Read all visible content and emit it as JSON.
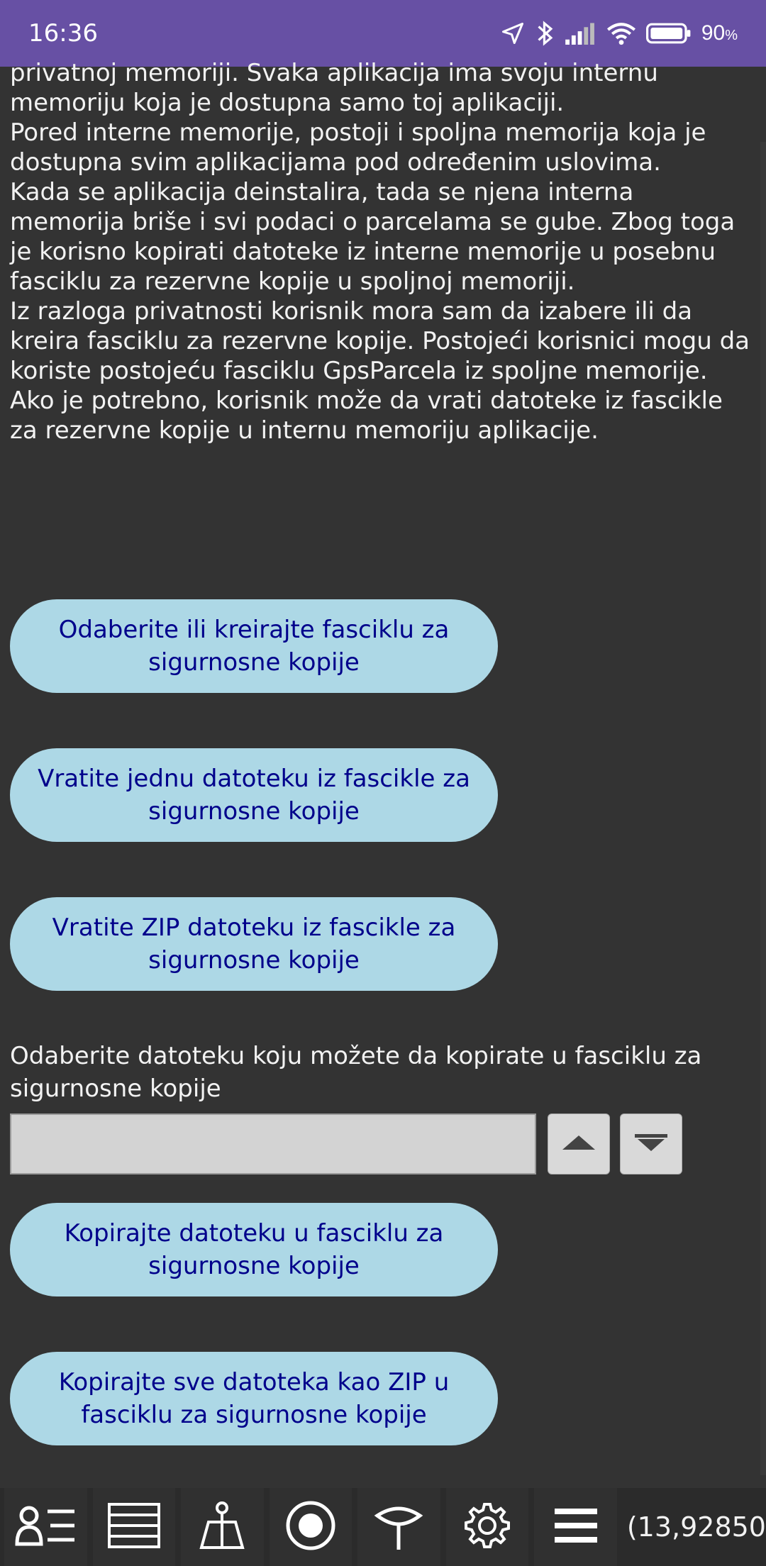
{
  "status_bar": {
    "time": "16:36",
    "battery": "90",
    "battery_unit": "%",
    "icons": [
      "location-arrow-icon",
      "bluetooth-icon",
      "signal-icon",
      "wifi-icon",
      "battery-icon"
    ]
  },
  "info_text": {
    "p1": "privatnoj memoriji. Svaka aplikacija ima svoju internu memoriju koja je dostupna samo toj aplikaciji.",
    "p2": "Pored interne memorije, postoji i spoljna memorija koja je dostupna svim aplikacijama pod određenim uslovima.",
    "p3": "Kada se aplikacija deinstalira, tada se njena interna memorija briše i svi podaci o parcelama se gube. Zbog toga je korisno kopirati datoteke iz interne memorije u posebnu fasciklu za rezervne kopije u spoljnoj memoriji.",
    "p4": "Iz razloga privatnosti korisnik mora sam da izabere ili da kreira fasciklu za rezervne kopije. Postojeći korisnici mogu da koriste postojeću fasciklu GpsParcela iz spoljne memorije.",
    "p5": "Ako je potrebno, korisnik može da vrati datoteke iz fascikle za rezervne kopije u internu memoriju aplikacije."
  },
  "buttons": {
    "choose_folder": "Odaberite ili kreirajte fasciklu za sigurnosne kopije",
    "restore_one": "Vratite jednu datoteku iz fascikle za sigurnosne kopije",
    "restore_zip": "Vratite ZIP datoteku iz fascikle za sigurnosne kopije",
    "copy_file": "Kopirajte datoteku u fasciklu za sigurnosne kopije",
    "copy_all_zip": "Kopirajte sve datoteka kao ZIP u fasciklu za sigurnosne kopije"
  },
  "file_select": {
    "label": "Odaberite datoteku koju možete da kopirate u fasciklu za sigurnosne kopije",
    "value": ""
  },
  "bottom_bar": {
    "icons": [
      "user-list-icon",
      "layers-icon",
      "survey-tripod-icon",
      "record-icon",
      "location-pin-icon",
      "gear-icon",
      "menu-icon"
    ],
    "coordinates": "(13,92850"
  }
}
